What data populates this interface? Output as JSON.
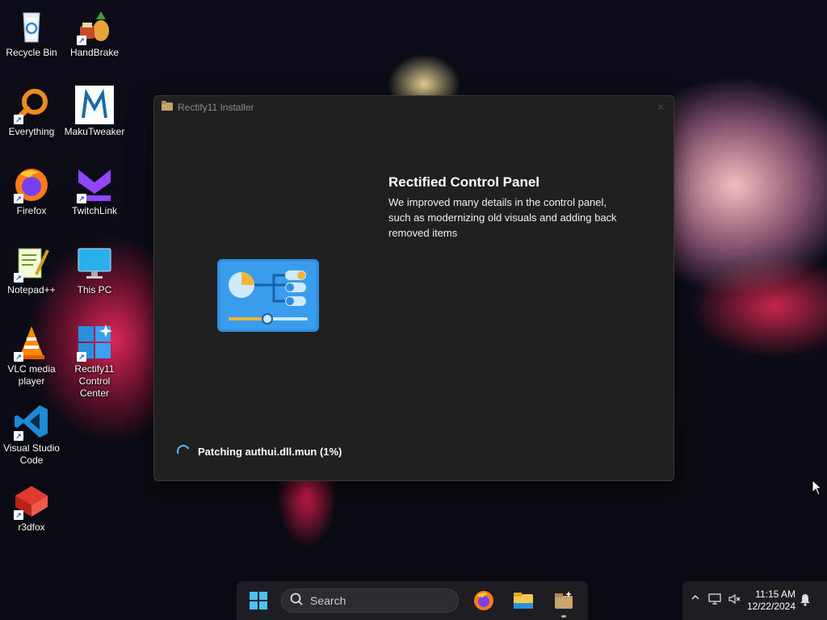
{
  "desktop": {
    "icons": [
      {
        "label": "Recycle Bin",
        "icon": "recycle-bin-icon"
      },
      {
        "label": "HandBrake",
        "icon": "handbrake-icon"
      },
      {
        "label": "Everything",
        "icon": "everything-search-icon"
      },
      {
        "label": "MakuTweaker",
        "icon": "makutweaker-icon"
      },
      {
        "label": "Firefox",
        "icon": "firefox-icon"
      },
      {
        "label": "TwitchLink",
        "icon": "twitchlink-icon"
      },
      {
        "label": "Notepad++",
        "icon": "notepadpp-icon"
      },
      {
        "label": "This PC",
        "icon": "this-pc-icon"
      },
      {
        "label": "VLC media player",
        "icon": "vlc-icon"
      },
      {
        "label": "Rectify11 Control Center",
        "icon": "rectify11-icon"
      },
      {
        "label": "Visual Studio Code",
        "icon": "vscode-icon"
      },
      {
        "label": "r3dfox",
        "icon": "r3dfox-icon"
      }
    ]
  },
  "installer": {
    "title": "Rectify11 Installer",
    "feature_title": "Rectified Control Panel",
    "feature_description": "We improved many details in the control panel, such as modernizing old visuals and adding back removed items",
    "status": "Patching authui.dll.mun (1%)",
    "progress_percent": 1
  },
  "taskbar": {
    "search_label": "Search",
    "apps": [
      "firefox-icon",
      "file-explorer-icon",
      "rectify11-installer-icon"
    ]
  },
  "tray": {
    "time": "11:15 AM",
    "date": "12/22/2024"
  },
  "colors": {
    "accent": "#4cc2ff",
    "window_bg": "#202020"
  }
}
